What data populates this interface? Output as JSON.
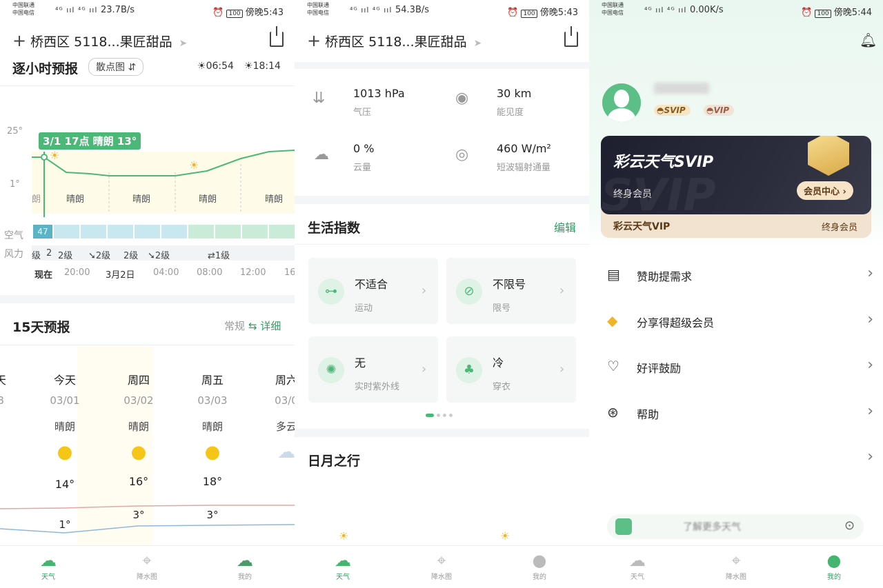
{
  "status": [
    {
      "carrier1": "中国联通",
      "carrier2": "中国电信",
      "signal": "⁴ᴳ ııl ⁴ᴳ ııl",
      "speed": "23.7B/s",
      "battery": "100",
      "time": "傍晚5:43"
    },
    {
      "carrier1": "中国联通",
      "carrier2": "中国电信",
      "signal": "⁴ᴳ ııl ⁴ᴳ ııl",
      "speed": "54.3B/s",
      "battery": "100",
      "time": "傍晚5:43"
    },
    {
      "carrier1": "中国联通",
      "carrier2": "中国电信",
      "signal": "⁴ᴳ ııl ⁴ᴳ ııl",
      "speed": "0.00K/s",
      "battery": "100",
      "time": "傍晚5:44"
    }
  ],
  "location": "桥西区 5118...果匠甜品",
  "hourly": {
    "title": "逐小时预报",
    "mode": "散点图",
    "sunrise": "06:54",
    "sunset": "18:14",
    "ymax": "25°",
    "ymin": "1°",
    "tooltip": "3/1  17点  晴朗 13°",
    "conds": [
      "朗",
      "晴朗",
      "晴朗",
      "晴朗",
      "晴朗"
    ],
    "air_label": "空气",
    "aqi": "47",
    "wind_label": "风力",
    "winds": [
      "级",
      "2",
      "2级",
      "➘2级",
      "2级",
      "➘2级",
      "⇄1级"
    ],
    "times": [
      "现在",
      "20:00",
      "3月2日",
      "04:00",
      "08:00",
      "12:00",
      "16"
    ]
  },
  "forecast": {
    "title": "15天预报",
    "normal": "常规",
    "detail": "⇆ 详细",
    "days": [
      {
        "name": "天",
        "date": "8",
        "cond": "",
        "high": "",
        "low": ""
      },
      {
        "name": "今天",
        "date": "03/01",
        "cond": "晴朗",
        "high": "14°",
        "low": "1°"
      },
      {
        "name": "周四",
        "date": "03/02",
        "cond": "晴朗",
        "high": "16°",
        "low": "3°"
      },
      {
        "name": "周五",
        "date": "03/03",
        "cond": "晴朗",
        "high": "18°",
        "low": "3°"
      },
      {
        "name": "周六",
        "date": "03/0",
        "cond": "多云",
        "high": "",
        "low": ""
      }
    ]
  },
  "details": [
    {
      "value": "1013 hPa",
      "label": "气压",
      "icon": "pressure-icon"
    },
    {
      "value": "30 km",
      "label": "能见度",
      "icon": "eye-icon"
    },
    {
      "value": "0 %",
      "label": "云量",
      "icon": "cloud-icon"
    },
    {
      "value": "460 W/m²",
      "label": "短波辐射通量",
      "icon": "radiation-icon"
    }
  ],
  "life": {
    "title": "生活指数",
    "edit": "编辑",
    "items": [
      {
        "value": "不适合",
        "label": "运动",
        "icon": "dumbbell-icon"
      },
      {
        "value": "不限号",
        "label": "限号",
        "icon": "car-icon"
      },
      {
        "value": "无",
        "label": "实时紫外线",
        "icon": "uv-icon"
      },
      {
        "value": "冷",
        "label": "穿衣",
        "icon": "shirt-icon"
      }
    ]
  },
  "sunmoon": {
    "title": "日月之行"
  },
  "tabs": [
    "天气",
    "降水图",
    "我的"
  ],
  "profile": {
    "username": "***",
    "badge_svip": "SVIP",
    "badge_vip": "VIP",
    "card_title": "彩云天气SVIP",
    "card_sub": "终身会员",
    "card_btn": "会员中心 ›",
    "card_watermark": "SVIP",
    "vip_title": "彩云天气VIP",
    "vip_sub": "终身会员",
    "menu": [
      {
        "label": "赞助提需求",
        "icon": "clipboard-icon"
      },
      {
        "label": "分享得超级会员",
        "icon": "diamond-icon"
      },
      {
        "label": "好评鼓励",
        "icon": "heart-icon"
      },
      {
        "label": "帮助",
        "icon": "lifebuoy-icon"
      },
      {
        "label": "",
        "icon": ""
      }
    ],
    "banner": "了解更多天气"
  }
}
